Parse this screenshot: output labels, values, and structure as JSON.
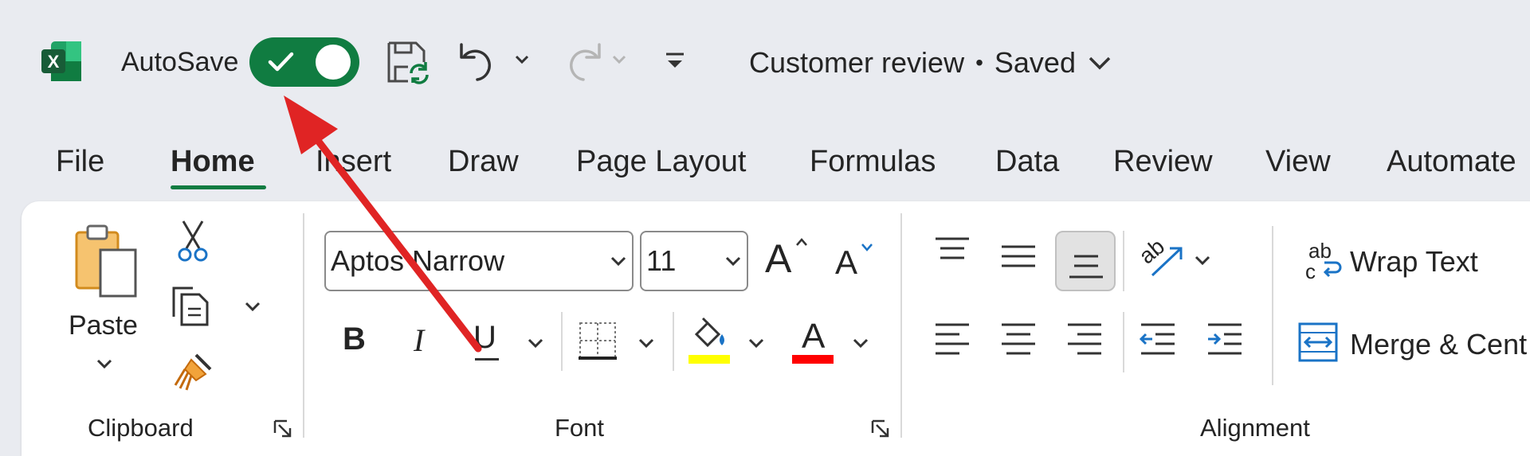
{
  "app": {
    "autosave_label": "AutoSave",
    "autosave_on": true,
    "document_title": "Customer review",
    "separator": "•",
    "save_status": "Saved",
    "accent": "#107c41"
  },
  "tabs": [
    {
      "label": "File",
      "active": false
    },
    {
      "label": "Home",
      "active": true
    },
    {
      "label": "Insert",
      "active": false
    },
    {
      "label": "Draw",
      "active": false
    },
    {
      "label": "Page Layout",
      "active": false
    },
    {
      "label": "Formulas",
      "active": false
    },
    {
      "label": "Data",
      "active": false
    },
    {
      "label": "Review",
      "active": false
    },
    {
      "label": "View",
      "active": false
    },
    {
      "label": "Automate",
      "active": false
    }
  ],
  "clipboard": {
    "paste_label": "Paste",
    "group_label": "Clipboard"
  },
  "font": {
    "font_name": "Aptos Narrow",
    "font_size": "11",
    "group_label": "Font",
    "bold": "B",
    "italic": "I",
    "underline": "U",
    "grow": "A",
    "shrink": "A",
    "font_color_glyph": "A",
    "highlight_color": "#ffff00",
    "font_color": "#ff0000"
  },
  "alignment": {
    "wrap_text": "Wrap Text",
    "merge_center": "Merge & Cent",
    "group_label": "Alignment",
    "orient_glyph": "ab",
    "wrap_glyph_top": "ab",
    "wrap_glyph_bottom": "c"
  },
  "annotation": {
    "arrow_color": "#e02424"
  }
}
